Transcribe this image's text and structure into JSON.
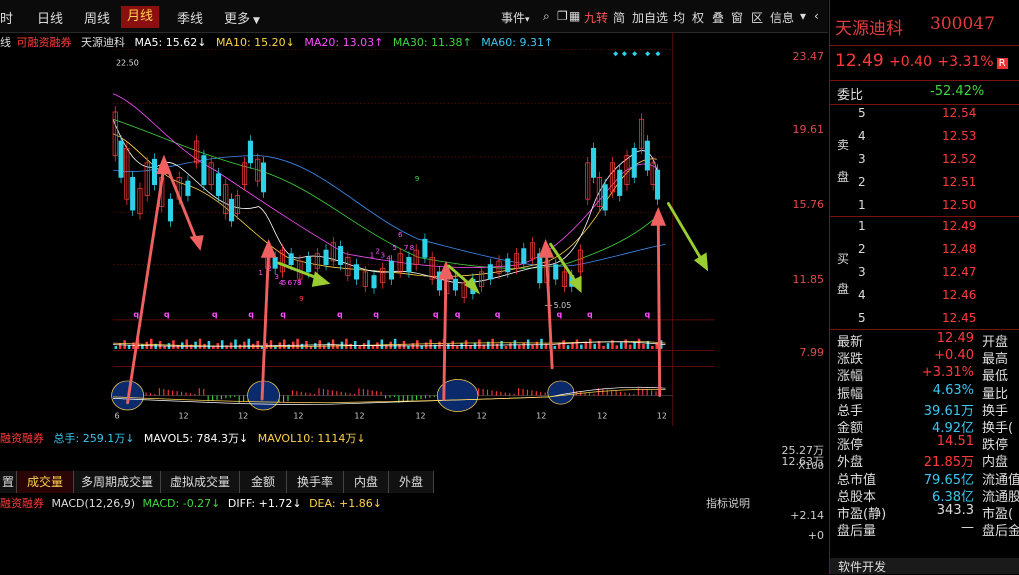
{
  "toolbar": {
    "left_cut": "时",
    "items": [
      "日线",
      "周线",
      "月线",
      "季线",
      "更多"
    ],
    "active": "月线",
    "right_items": [
      "事件",
      "九转",
      "简",
      "加自选",
      "均",
      "权",
      "叠",
      "窗",
      "区",
      "信息"
    ]
  },
  "ma_line": {
    "prefix": "线",
    "tag": "可融资融券",
    "name": "天源迪科",
    "ma5": "MA5: 15.62↓",
    "ma10": "MA10: 15.20↓",
    "ma20": "MA20: 13.03↑",
    "ma30": "MA30: 11.38↑",
    "ma60": "MA60: 9.31↑"
  },
  "chart": {
    "top_left_price": "22.50",
    "price_ticks": [
      "23.47",
      "19.61",
      "15.76",
      "11.85",
      "7.99"
    ],
    "low_label": "5.05",
    "nine_labels": [
      "9",
      "9",
      "1",
      "2",
      "3",
      "4",
      "5",
      "6",
      "7",
      "8",
      "1",
      "2",
      "3",
      "4",
      "5",
      "6",
      "7",
      "8",
      "6"
    ],
    "q_marks": [
      "q",
      "q",
      "q",
      "q",
      "q",
      "q",
      "q",
      "q",
      "q",
      "q",
      "q",
      "q",
      "q"
    ],
    "bottom_ticks": [
      "6",
      "12",
      "12",
      "12",
      "12",
      "12",
      "12",
      "12",
      "12",
      "12"
    ],
    "colors": {
      "up": "#ff3a3a",
      "down": "#2fd1e6",
      "ma5": "#ffffff",
      "ma10": "#ffd24a",
      "ma20": "#ff4dff",
      "ma30": "#3fd63f",
      "ma60": "#3c8cf0",
      "arrow_red": "#f06060",
      "arrow_green": "#9acd32"
    }
  },
  "volume": {
    "tag": "融资融券",
    "total": "总手: 259.1万↓",
    "mavol5": "MAVOL5: 784.3万↓",
    "mavol10": "MAVOL10: 1114万↓",
    "axis_top": "25.27万",
    "axis_mid": "12.63万",
    "axis_unit": "X100"
  },
  "tabs": [
    "置",
    "成交量",
    "多周期成交量",
    "虚拟成交量",
    "金额",
    "换手率",
    "内盘",
    "外盘"
  ],
  "active_tab": "成交量",
  "macd": {
    "tag": "融资融券",
    "label": "MACD(12,26,9)",
    "macd": "MACD: -0.27↓",
    "diff": "DIFF: +1.72↓",
    "dea": "DEA: +1.86↓",
    "help": "指标说明",
    "axis_top": "+2.14",
    "axis_zero": "+0"
  },
  "panel": {
    "name": "天源迪科",
    "code": "300047",
    "price": "12.49",
    "change": "+0.40",
    "pct": "+3.31%",
    "rz": "R",
    "ratio_label": "委比",
    "ratio": "-52.42%",
    "sell_label": [
      "卖",
      "盘"
    ],
    "buy_label": [
      "买",
      "盘"
    ],
    "sell": [
      {
        "i": "5",
        "p": "12.54"
      },
      {
        "i": "4",
        "p": "12.53"
      },
      {
        "i": "3",
        "p": "12.52"
      },
      {
        "i": "2",
        "p": "12.51"
      },
      {
        "i": "1",
        "p": "12.50"
      }
    ],
    "buy": [
      {
        "i": "1",
        "p": "12.49"
      },
      {
        "i": "2",
        "p": "12.48"
      },
      {
        "i": "3",
        "p": "12.47"
      },
      {
        "i": "4",
        "p": "12.46"
      },
      {
        "i": "5",
        "p": "12.45"
      }
    ],
    "stats": [
      {
        "l": "最新",
        "v": "12.49",
        "r": "开盘",
        "c": "red"
      },
      {
        "l": "涨跌",
        "v": "+0.40",
        "r": "最高",
        "c": "red"
      },
      {
        "l": "涨幅",
        "v": "+3.31%",
        "r": "最低",
        "c": "red"
      },
      {
        "l": "振幅",
        "v": "4.63%",
        "r": "量比",
        "c": "cyan"
      },
      {
        "l": "总手",
        "v": "39.61万",
        "r": "换手",
        "c": "cyan"
      },
      {
        "l": "金额",
        "v": "4.92亿",
        "r": "换手(",
        "c": "cyan"
      },
      {
        "l": "涨停",
        "v": "14.51",
        "r": "跌停",
        "c": "red"
      },
      {
        "l": "外盘",
        "v": "21.85万",
        "r": "内盘",
        "c": "red"
      },
      {
        "l": "总市值",
        "v": "79.65亿",
        "r": "流通值",
        "c": "cyan"
      },
      {
        "l": "总股本",
        "v": "6.38亿",
        "r": "流通股",
        "c": "cyan"
      },
      {
        "l": "市盈(静)",
        "v": "343.3",
        "r": "市盈(",
        "c": "grey"
      },
      {
        "l": "盘后量",
        "v": "—",
        "r": "盘后金",
        "c": "grey"
      }
    ],
    "bottom": "软件开发"
  }
}
